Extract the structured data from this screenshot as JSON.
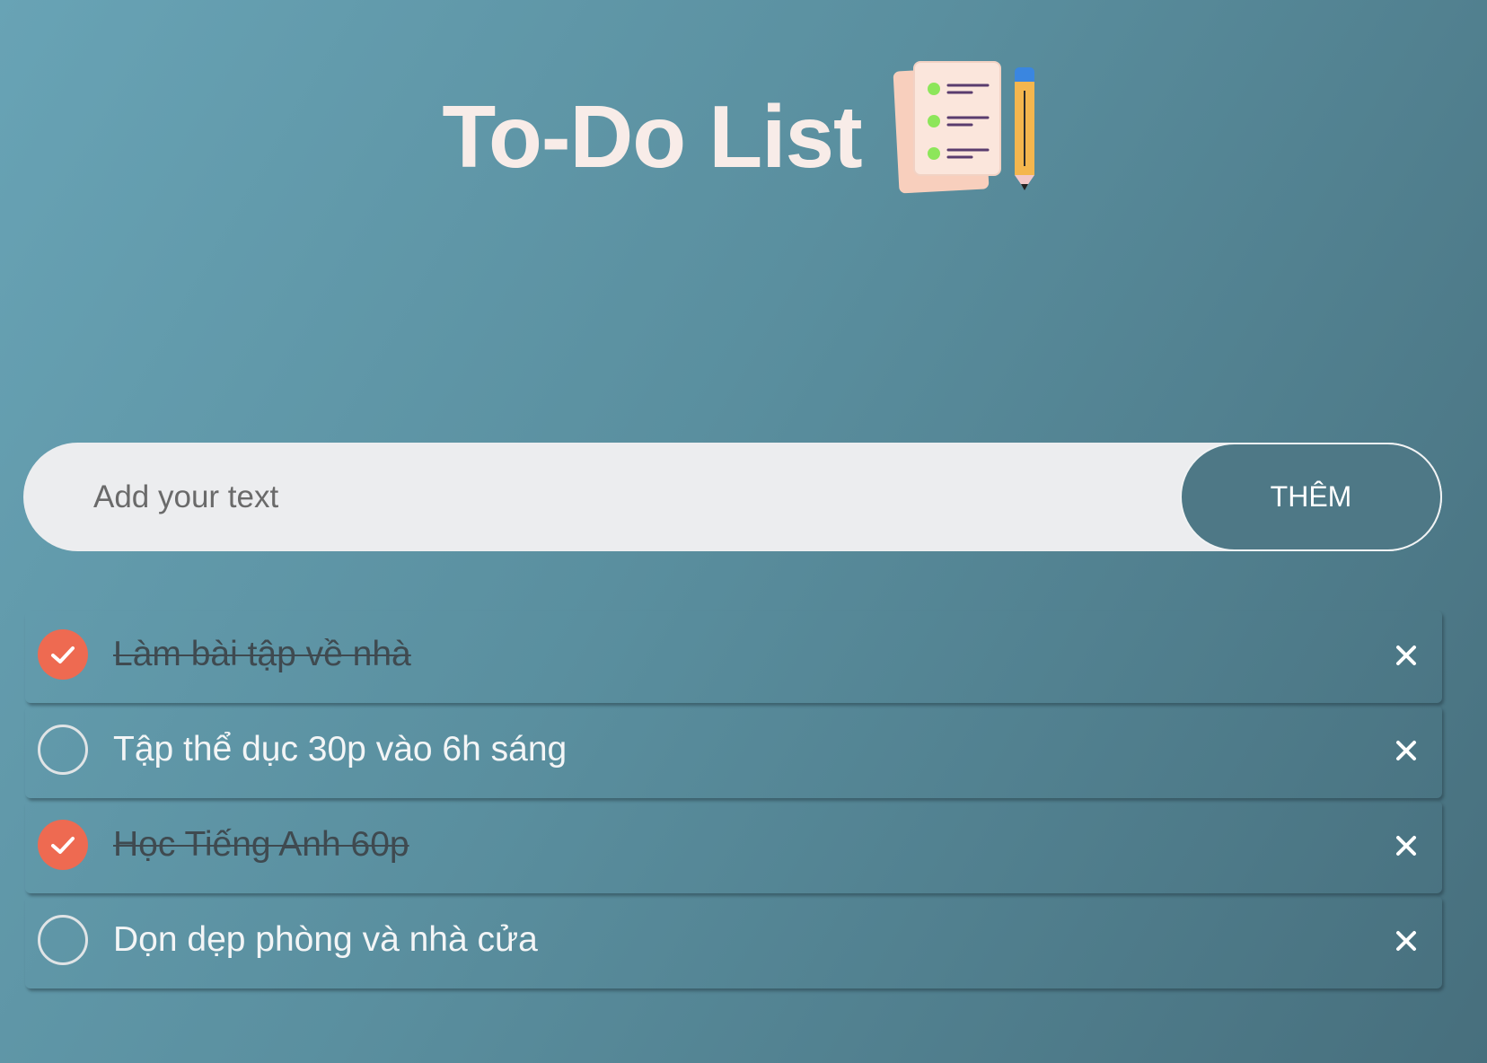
{
  "header": {
    "title": "To-Do List",
    "logo_icon": "checklist-with-pencil-icon"
  },
  "input": {
    "placeholder": "Add your text",
    "value": "",
    "button_label": "THÊM"
  },
  "todos": [
    {
      "label": "Làm bài tập về nhà",
      "done": true
    },
    {
      "label": "Tập thể dục 30p vào 6h sáng",
      "done": false
    },
    {
      "label": "Học Tiếng Anh 60p",
      "done": true
    },
    {
      "label": "Dọn dẹp phòng và nhà cửa",
      "done": false
    }
  ],
  "colors": {
    "background_start": "#68a3b5",
    "background_end": "#476f7d",
    "title": "#f8ece8",
    "input_bg": "#ecedef",
    "button_bg": "#4e7886",
    "check_done": "#ee6a51",
    "done_text": "#3f4a50",
    "open_text": "#f3f5f6"
  },
  "icons": {
    "check": "checkmark-icon",
    "delete": "close-icon"
  }
}
